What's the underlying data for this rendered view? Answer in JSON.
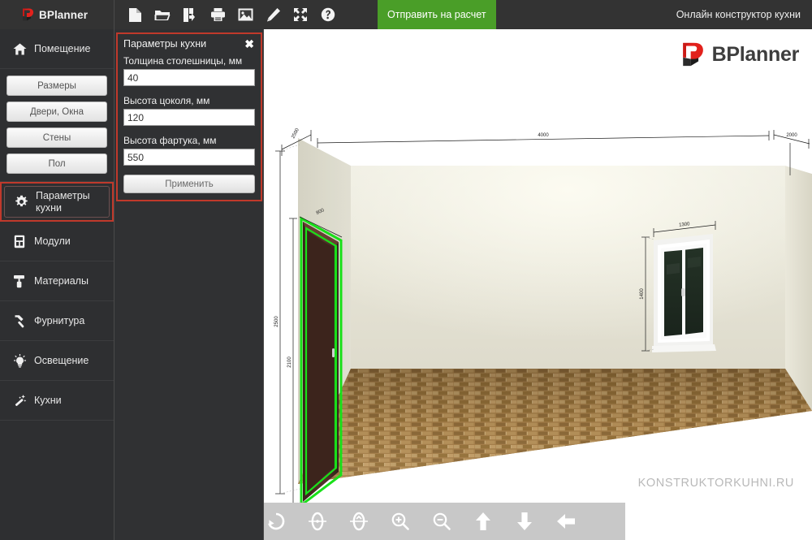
{
  "app": {
    "brand": "BPlanner",
    "header_right": "Онлайн конструктор кухни",
    "calc_button": "Отправить на расчет"
  },
  "toolbar": {
    "icons": [
      {
        "name": "new-file-icon",
        "title": "Новый"
      },
      {
        "name": "open-folder-icon",
        "title": "Открыть"
      },
      {
        "name": "save-icon",
        "title": "Сохранить"
      },
      {
        "name": "print-icon",
        "title": "Печать"
      },
      {
        "name": "image-export-icon",
        "title": "Изображение"
      },
      {
        "name": "pencil-edit-icon",
        "title": "Редактировать"
      },
      {
        "name": "fullscreen-icon",
        "title": "На весь экран"
      },
      {
        "name": "help-icon",
        "title": "Справка"
      }
    ]
  },
  "sidebar": {
    "items": [
      {
        "label": "Помещение",
        "icon": "home-icon",
        "active": false,
        "twoline": false
      },
      {
        "label_line1": "Параметры",
        "label_line2": "кухни",
        "icon": "gear-icon",
        "active": true,
        "twoline": true
      },
      {
        "label": "Модули",
        "icon": "module-icon",
        "active": false,
        "twoline": false
      },
      {
        "label": "Материалы",
        "icon": "paint-roller-icon",
        "active": false,
        "twoline": false
      },
      {
        "label": "Фурнитура",
        "icon": "hammer-icon",
        "active": false,
        "twoline": false
      },
      {
        "label": "Освещение",
        "icon": "lightbulb-icon",
        "active": false,
        "twoline": false
      },
      {
        "label": "Кухни",
        "icon": "magic-wand-icon",
        "active": false,
        "twoline": false
      }
    ],
    "sub_buttons": [
      {
        "label": "Размеры"
      },
      {
        "label": "Двери, Окна"
      },
      {
        "label": "Стены"
      },
      {
        "label": "Пол"
      }
    ]
  },
  "params_panel": {
    "title": "Параметры кухни",
    "close": "✖",
    "fields": [
      {
        "label": "Толщина столешницы, мм",
        "value": "40",
        "placeholder": "40"
      },
      {
        "label": "Высота цоколя, мм",
        "value": "120",
        "placeholder": "120"
      },
      {
        "label": "Высота фартука, мм",
        "value": "550",
        "placeholder": "550"
      }
    ],
    "apply_label": "Применить"
  },
  "viewport": {
    "logo_text": "BPlanner",
    "watermark": "KONSTRUKTORKUHNI.RU",
    "dimensions": {
      "back_wall_width": "4000",
      "right_wall_depth": "2000",
      "window_width": "1300",
      "window_height": "1400",
      "door_width": "800",
      "door_height": "2100",
      "room_height": "2500"
    }
  },
  "bottom_toolbar": {
    "buttons": [
      {
        "name": "rotate-left-icon",
        "label": "Поворот влево"
      },
      {
        "name": "rotate-vertical-a-icon",
        "label": "Вращение по горизонтали"
      },
      {
        "name": "rotate-vertical-b-icon",
        "label": "Вращение по вертикали"
      },
      {
        "name": "zoom-in-icon",
        "label": "Приблизить"
      },
      {
        "name": "zoom-out-icon",
        "label": "Отдалить"
      },
      {
        "name": "move-up-icon",
        "label": "Вверх"
      },
      {
        "name": "move-down-icon",
        "label": "Вниз"
      },
      {
        "name": "move-left-icon",
        "label": "Влево"
      }
    ]
  },
  "colors": {
    "header_bg": "#333333",
    "sidebar_bg": "#2e2f31",
    "accent_red": "#c0392b",
    "accent_green": "#4a9e28",
    "panel_bg": "#303133",
    "bottom_bar_bg": "#c8c8c8",
    "logo_red": "#e2211c"
  }
}
